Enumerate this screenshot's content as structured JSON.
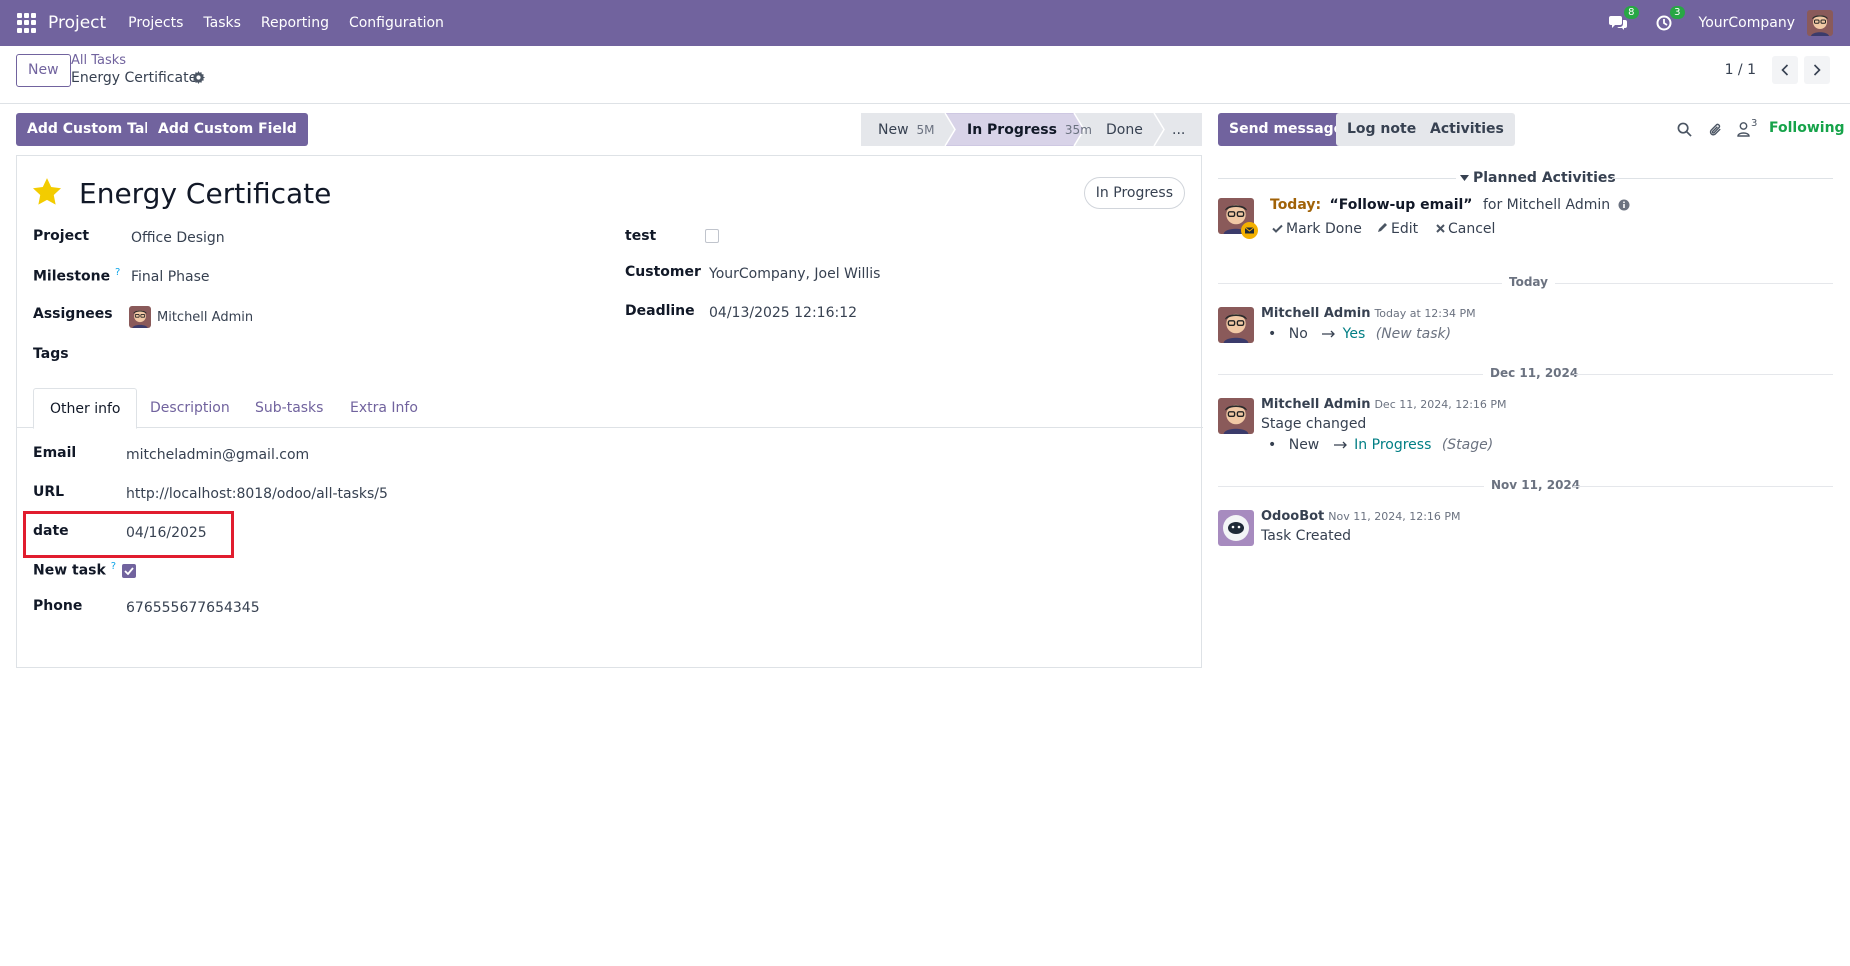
{
  "navbar": {
    "app_name": "Project",
    "menu": [
      "Projects",
      "Tasks",
      "Reporting",
      "Configuration"
    ],
    "messages_count": "8",
    "activities_count": "3",
    "company": "YourCompany"
  },
  "control_panel": {
    "new_label": "New",
    "breadcrumb_parent": "All Tasks",
    "breadcrumb_current": "Energy Certificate",
    "pager": "1 / 1"
  },
  "actions": {
    "add_custom_tab": "Add Custom Tab",
    "add_custom_field": "Add Custom Field"
  },
  "statusbar": {
    "stages": [
      {
        "name": "New",
        "time": "5M"
      },
      {
        "name": "In Progress",
        "time": "35m"
      },
      {
        "name": "Done",
        "time": ""
      },
      {
        "name": "...",
        "time": ""
      }
    ]
  },
  "form": {
    "title": "Energy Certificate",
    "status_badge": "In Progress",
    "fields": {
      "project_label": "Project",
      "project_value": "Office Design",
      "milestone_label": "Milestone",
      "milestone_value": "Final Phase",
      "assignees_label": "Assignees",
      "assignees_value": "Mitchell Admin",
      "tags_label": "Tags",
      "test_label": "test",
      "customer_label": "Customer",
      "customer_value": "YourCompany, Joel Willis",
      "deadline_label": "Deadline",
      "deadline_value": "04/13/2025 12:16:12"
    },
    "tabs": [
      "Other info",
      "Description",
      "Sub-tasks",
      "Extra Info"
    ],
    "other_info": {
      "email_label": "Email",
      "email_value": "mitcheladmin@gmail.com",
      "url_label": "URL",
      "url_value": "http://localhost:8018/odoo/all-tasks/5",
      "date_label": "date",
      "date_value": "04/16/2025",
      "newtask_label": "New task",
      "phone_label": "Phone",
      "phone_value": "676555677654345"
    },
    "help_mark": "?"
  },
  "chatter": {
    "send_message": "Send message",
    "log_note": "Log note",
    "activities": "Activities",
    "followers_count": "3",
    "following": "Following",
    "planned_title": "Planned Activities",
    "activity": {
      "when": "Today:",
      "summary": "“Follow-up email”",
      "for_text": "for Mitchell Admin",
      "mark_done": "Mark Done",
      "edit": "Edit",
      "cancel": "Cancel"
    },
    "sep_today": "Today",
    "msg1": {
      "author": "Mitchell Admin",
      "time": "Today at 12:34 PM",
      "old": "No",
      "new": "Yes",
      "field": "(New task)"
    },
    "sep_dec": "Dec 11, 2024",
    "msg2": {
      "author": "Mitchell Admin",
      "time": "Dec 11, 2024, 12:16 PM",
      "body": "Stage changed",
      "old": "New",
      "new": "In Progress",
      "field": "(Stage)"
    },
    "sep_nov": "Nov 11, 2024",
    "msg3": {
      "author": "OdooBot",
      "time": "Nov 11, 2024, 12:16 PM",
      "body": "Task Created"
    }
  },
  "colors": {
    "brand": "#71639e",
    "success": "#16a34a",
    "link_teal": "#017e84",
    "highlight": "#e11d2e"
  }
}
